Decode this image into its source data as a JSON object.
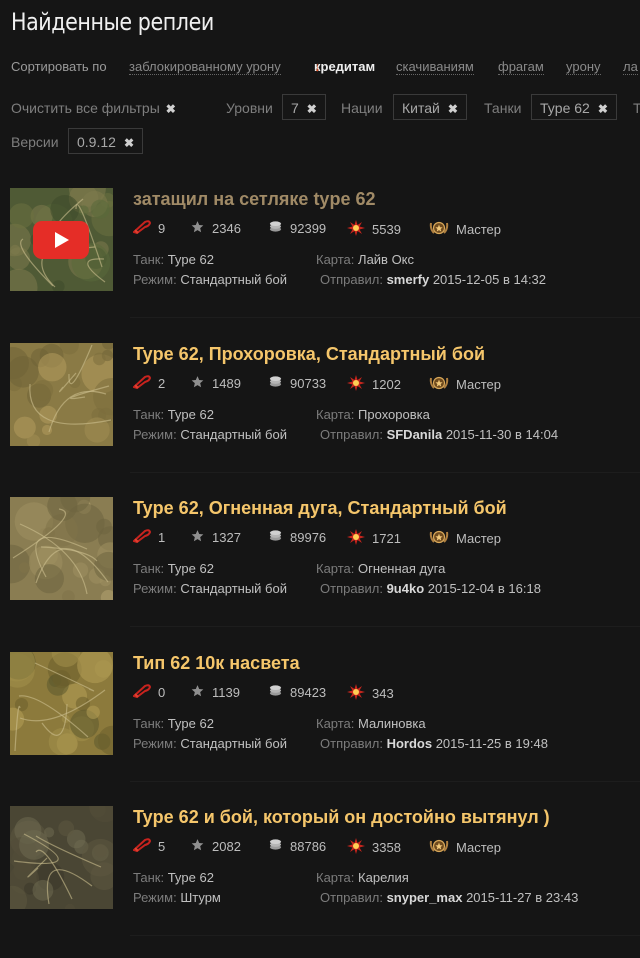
{
  "page_title": "Найденные реплеи",
  "sort": {
    "prefix": "Сортировать по",
    "options": [
      {
        "label": "заблокированному урону",
        "active": false
      },
      {
        "label": "кредитам",
        "active": true,
        "arrow": "↓"
      },
      {
        "label": "скачиваниям",
        "active": false
      },
      {
        "label": "фрагам",
        "active": false
      },
      {
        "label": "урону",
        "active": false
      },
      {
        "label": "ла",
        "active": false
      }
    ]
  },
  "filters": {
    "clear_all": "Очистить все фильтры",
    "close_glyph": "✖",
    "levels_label": "Уровни",
    "levels_value": "7",
    "nations_label": "Нации",
    "nations_value": "Китай",
    "tanks_label": "Танки",
    "tanks_value": "Type 62",
    "cut_label": "Т",
    "versions_label": "Версии",
    "versions_value": "0.9.12"
  },
  "labels": {
    "tank": "Танк:",
    "map": "Карта:",
    "mode": "Режим:",
    "sender": "Отправил:",
    "at": "в"
  },
  "replays": [
    {
      "title": "затащил на сетляке type 62",
      "visited": true,
      "has_video": true,
      "frags": "9",
      "rating": "2346",
      "credits": "92399",
      "damage": "5539",
      "badge": "Мастер",
      "tank": "Type 62",
      "map": "Лайв Окс",
      "mode": "Стандартный бой",
      "user": "smerfy",
      "date": "2015-12-05",
      "time": "14:32"
    },
    {
      "title": "Type 62, Прохоровка, Стандартный бой",
      "visited": false,
      "has_video": false,
      "frags": "2",
      "rating": "1489",
      "credits": "90733",
      "damage": "1202",
      "badge": "Мастер",
      "tank": "Type 62",
      "map": "Прохоровка",
      "mode": "Стандартный бой",
      "user": "SFDanila",
      "date": "2015-11-30",
      "time": "14:04"
    },
    {
      "title": "Type 62, Огненная дуга, Стандартный бой",
      "visited": false,
      "has_video": false,
      "frags": "1",
      "rating": "1327",
      "credits": "89976",
      "damage": "1721",
      "badge": "Мастер",
      "tank": "Type 62",
      "map": "Огненная дуга",
      "mode": "Стандартный бой",
      "user": "9u4ko",
      "date": "2015-12-04",
      "time": "16:18"
    },
    {
      "title": "Тип 62 10к насвета",
      "visited": false,
      "has_video": false,
      "frags": "0",
      "rating": "1139",
      "credits": "89423",
      "damage": "343",
      "badge": "",
      "tank": "Type 62",
      "map": "Малиновка",
      "mode": "Стандартный бой",
      "user": "Hordos",
      "date": "2015-11-25",
      "time": "19:48"
    },
    {
      "title": "Type 62 и бой, который он достойно вытянул )",
      "visited": false,
      "has_video": false,
      "frags": "5",
      "rating": "2082",
      "credits": "88786",
      "damage": "3358",
      "badge": "Мастер",
      "tank": "Type 62",
      "map": "Карелия",
      "mode": "Штурм",
      "user": "snyper_max",
      "date": "2015-11-27",
      "time": "23:43"
    }
  ],
  "colors": {
    "background": "#151515",
    "title_gold": "#f5c66b",
    "title_visited": "#a08a66",
    "sort_arrow": "#e04a1a"
  },
  "icons": {
    "frags": "tank-shell-icon",
    "rating": "star-icon",
    "credits": "coins-icon",
    "damage": "explosion-icon",
    "badge": "mastery-badge-icon",
    "video": "youtube-play-icon"
  }
}
